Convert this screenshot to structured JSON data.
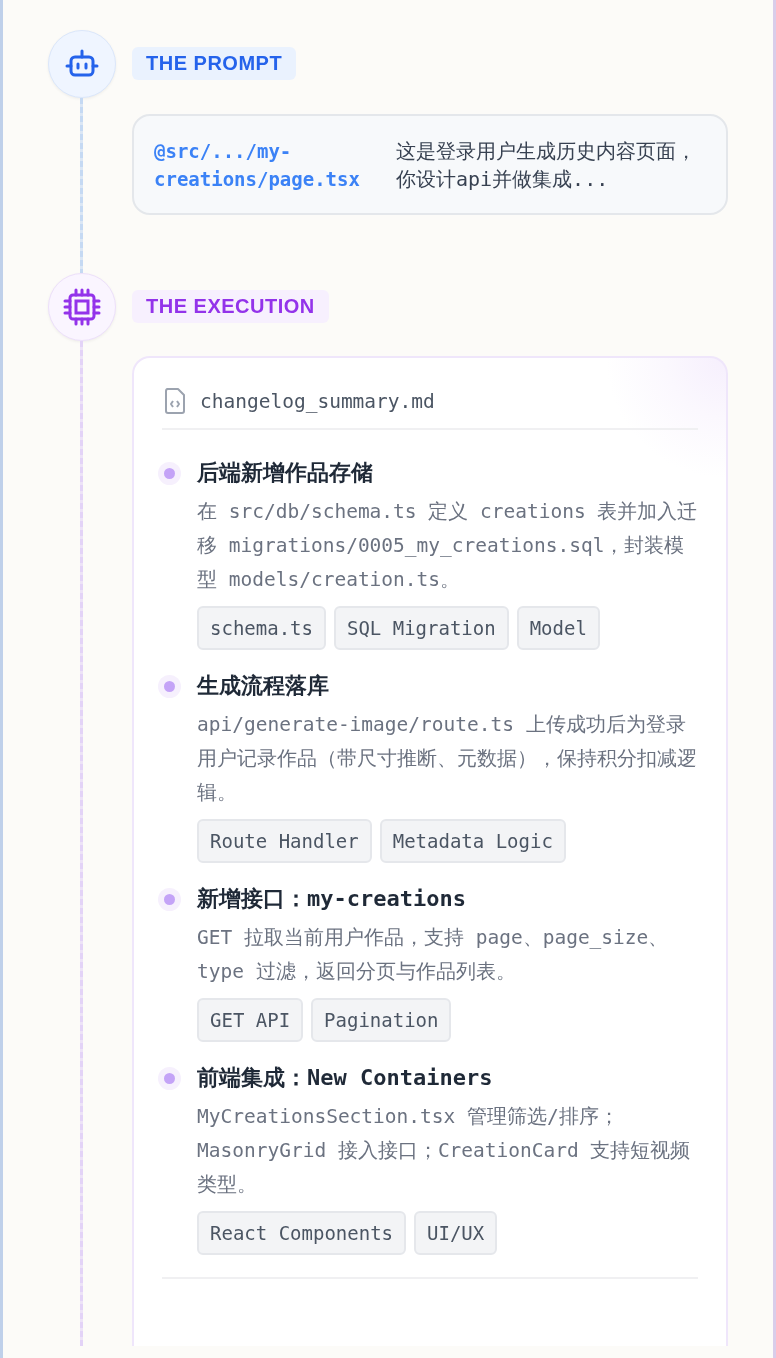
{
  "sections": [
    {
      "kind": "prompt",
      "label": "THE PROMPT",
      "path": "@src/.../my-creations/page.tsx",
      "message": "这是登录用户生成历史内容页面，你设计api并做集成..."
    },
    {
      "kind": "execution",
      "label": "THE EXECUTION",
      "file": "changelog_summary.md",
      "items": [
        {
          "title": "后端新增作品存储",
          "description": "在 src/db/schema.ts 定义 creations 表并加入迁移 migrations/0005_my_creations.sql，封装模型 models/creation.ts。",
          "tags": [
            "schema.ts",
            "SQL Migration",
            "Model"
          ]
        },
        {
          "title": "生成流程落库",
          "description": "api/generate-image/route.ts 上传成功后为登录用户记录作品（带尺寸推断、元数据），保持积分扣减逻辑。",
          "tags": [
            "Route Handler",
            "Metadata Logic"
          ]
        },
        {
          "title": "新增接口：my-creations",
          "description": "GET 拉取当前用户作品，支持 page、page_size、type 过滤，返回分页与作品列表。",
          "tags": [
            "GET API",
            "Pagination"
          ]
        },
        {
          "title": "前端集成：New Containers",
          "description": "MyCreationsSection.tsx 管理筛选/排序；MasonryGrid 接入接口；CreationCard 支持短视频类型。",
          "tags": [
            "React Components",
            "UI/UX"
          ]
        }
      ]
    }
  ]
}
